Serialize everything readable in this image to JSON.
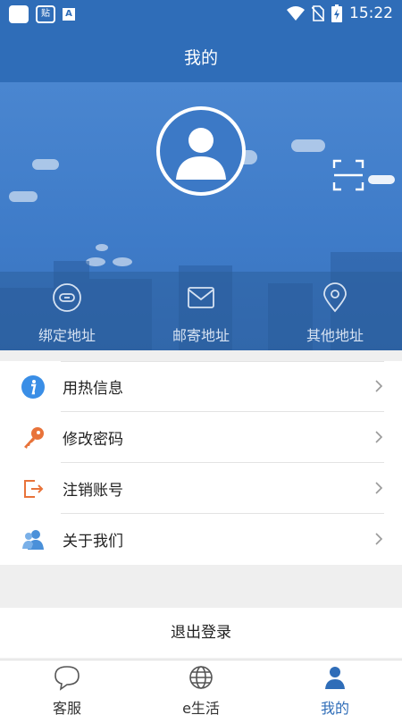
{
  "status_bar": {
    "time": "15:22",
    "icon_label_1": "贴",
    "icon_label_2": "A"
  },
  "header": {
    "title": "我的"
  },
  "address": {
    "items": [
      {
        "label": "绑定地址",
        "icon": "link-icon"
      },
      {
        "label": "邮寄地址",
        "icon": "mail-icon"
      },
      {
        "label": "其他地址",
        "icon": "location-pin-icon"
      }
    ]
  },
  "menu": {
    "items": [
      {
        "label": "用热信息",
        "icon": "info-icon"
      },
      {
        "label": "修改密码",
        "icon": "key-icon"
      },
      {
        "label": "注销账号",
        "icon": "logout-box-icon"
      },
      {
        "label": "关于我们",
        "icon": "users-icon"
      }
    ]
  },
  "logout": {
    "label": "退出登录"
  },
  "tabbar": {
    "items": [
      {
        "label": "客服",
        "icon": "chat-bubble-icon"
      },
      {
        "label": "e生活",
        "icon": "globe-icon"
      },
      {
        "label": "我的",
        "icon": "user-icon",
        "active": true
      }
    ]
  },
  "colors": {
    "primary": "#2f6db8",
    "info": "#3a8ee6",
    "key": "#e8733a",
    "logout_box": "#e8733a"
  }
}
